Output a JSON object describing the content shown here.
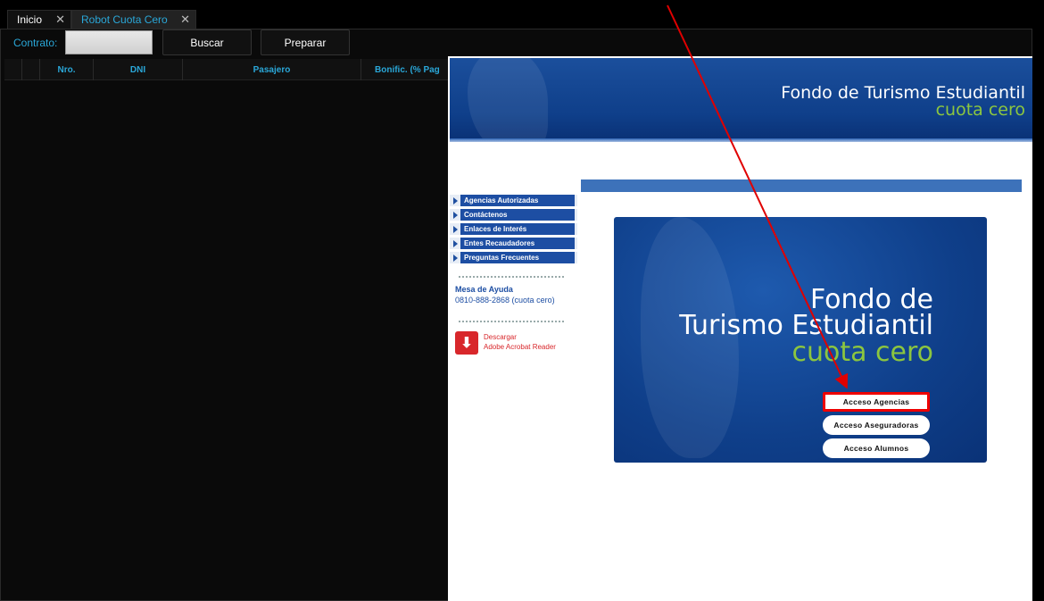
{
  "tabs": [
    {
      "label": "Inicio",
      "close": "✕"
    },
    {
      "label": "Robot Cuota Cero",
      "close": "✕"
    }
  ],
  "toolbar": {
    "contrato_label": "Contrato:",
    "contrato_value": "",
    "buscar_label": "Buscar",
    "preparar_label": "Preparar"
  },
  "grid": {
    "columns": [
      "",
      "",
      "Nro.",
      "DNI",
      "Pasajero",
      "Bonific. (% Pag"
    ]
  },
  "site": {
    "header_title": "Fondo de Turismo Estudiantil",
    "header_subtitle": "cuota cero",
    "menu": [
      "Agencias Autorizadas",
      "Contáctenos",
      "Enlaces de Interés",
      "Entes Recaudadores",
      "Preguntas Frecuentes"
    ],
    "help_title": "Mesa de Ayuda",
    "help_phone": "0810-888-2868 (cuota cero)",
    "pdf_line1": "Descargar",
    "pdf_line2": "Adobe Acrobat Reader",
    "hero_line1": "Fondo de",
    "hero_line2": "Turismo Estudiantil",
    "hero_line3": "cuota cero",
    "buttons": [
      "Acceso Agencias",
      "Acceso Aseguradoras",
      "Acceso Alumnos"
    ]
  },
  "colors": {
    "accent": "#2aa7d8",
    "brand_blue": "#1d4ea3",
    "brand_green": "#8cc63f",
    "annotation_red": "#e00000"
  }
}
